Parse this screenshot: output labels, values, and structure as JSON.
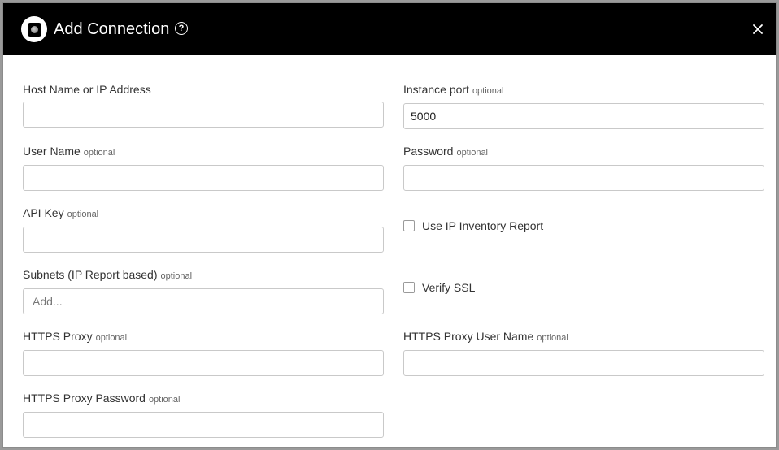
{
  "header": {
    "title": "Add Connection",
    "help_glyph": "?",
    "icons": {
      "logo": "app-logo-icon",
      "help": "help-circle-icon",
      "close": "close-icon"
    }
  },
  "form": {
    "optional_tag": "optional",
    "host": {
      "label": "Host Name or IP Address",
      "value": ""
    },
    "port": {
      "label": "Instance port",
      "value": "5000"
    },
    "username": {
      "label": "User Name",
      "value": ""
    },
    "password": {
      "label": "Password",
      "value": ""
    },
    "api_key": {
      "label": "API Key",
      "value": ""
    },
    "ip_inventory": {
      "label": "Use IP Inventory Report",
      "checked": false
    },
    "subnets": {
      "label": "Subnets (IP Report based)",
      "placeholder": "Add..."
    },
    "verify_ssl": {
      "label": "Verify SSL",
      "checked": false
    },
    "proxy": {
      "label": "HTTPS Proxy",
      "value": ""
    },
    "proxy_user": {
      "label": "HTTPS Proxy User Name",
      "value": ""
    },
    "proxy_password": {
      "label": "HTTPS Proxy Password",
      "value": ""
    }
  }
}
